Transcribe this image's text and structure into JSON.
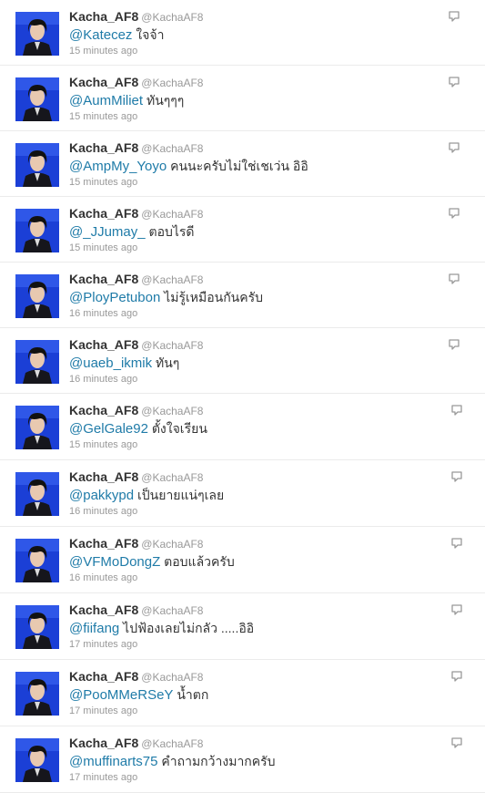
{
  "tweets": [
    {
      "name": "Kacha_AF8",
      "handle": "@KachaAF8",
      "mention": "@Katecez",
      "text": "ใจจ้า",
      "time": "15 minutes ago"
    },
    {
      "name": "Kacha_AF8",
      "handle": "@KachaAF8",
      "mention": "@AumMiliet",
      "text": "ทันๆๆๆ",
      "time": "15 minutes ago"
    },
    {
      "name": "Kacha_AF8",
      "handle": "@KachaAF8",
      "mention": "@AmpMy_Yoyo",
      "text": "คนนะครับไม่ใช่เชเว่น อิอิ",
      "time": "15 minutes ago"
    },
    {
      "name": "Kacha_AF8",
      "handle": "@KachaAF8",
      "mention": "@_JJumay_",
      "text": "ตอบไรดี",
      "time": "15 minutes ago"
    },
    {
      "name": "Kacha_AF8",
      "handle": "@KachaAF8",
      "mention": "@PloyPetubon",
      "text": "ไม่รู้เหมือนกันครับ",
      "time": "16 minutes ago"
    },
    {
      "name": "Kacha_AF8",
      "handle": "@KachaAF8",
      "mention": "@uaeb_ikmik",
      "text": "ทันๆ",
      "time": "16 minutes ago"
    },
    {
      "name": "Kacha_AF8",
      "handle": "@KachaAF8",
      "mention": "@GelGale92",
      "text": "ตั้งใจเรียน",
      "time": "15 minutes ago"
    },
    {
      "name": "Kacha_AF8",
      "handle": "@KachaAF8",
      "mention": "@pakkypd",
      "text": "เป็นยายแน่ๆเลย",
      "time": "16 minutes ago"
    },
    {
      "name": "Kacha_AF8",
      "handle": "@KachaAF8",
      "mention": "@VFMoDongZ",
      "text": "ตอบแล้วครับ",
      "time": "16 minutes ago"
    },
    {
      "name": "Kacha_AF8",
      "handle": "@KachaAF8",
      "mention": "@fiifang",
      "text": "ไปฟ้องเลยไม่กลัว .....อิอิ",
      "time": "17 minutes ago"
    },
    {
      "name": "Kacha_AF8",
      "handle": "@KachaAF8",
      "mention": "@PooMMeRSeY",
      "text": "น้ำตก",
      "time": "17 minutes ago"
    },
    {
      "name": "Kacha_AF8",
      "handle": "@KachaAF8",
      "mention": "@muffinarts75",
      "text": "คำถามกว้างมากครับ",
      "time": "17 minutes ago"
    }
  ]
}
